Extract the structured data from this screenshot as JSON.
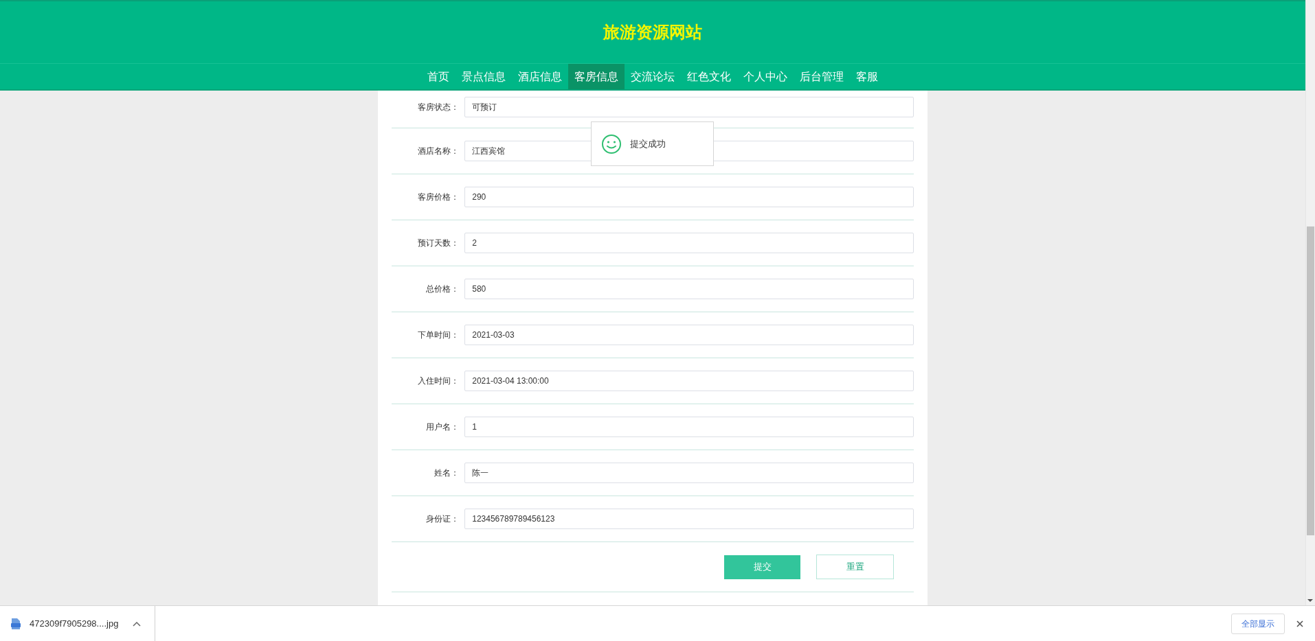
{
  "site_title": "旅游资源网站",
  "nav": [
    {
      "label": "首页",
      "selected": false
    },
    {
      "label": "景点信息",
      "selected": false
    },
    {
      "label": "酒店信息",
      "selected": false
    },
    {
      "label": "客房信息",
      "selected": true
    },
    {
      "label": "交流论坛",
      "selected": false
    },
    {
      "label": "红色文化",
      "selected": false
    },
    {
      "label": "个人中心",
      "selected": false
    },
    {
      "label": "后台管理",
      "selected": false
    },
    {
      "label": "客服",
      "selected": false
    }
  ],
  "form": {
    "fields": [
      {
        "label": "客房状态：",
        "value": "可预订"
      },
      {
        "label": "酒店名称：",
        "value": "江西宾馆"
      },
      {
        "label": "客房价格：",
        "value": "290"
      },
      {
        "label": "预订天数：",
        "value": "2"
      },
      {
        "label": "总价格：",
        "value": "580"
      },
      {
        "label": "下单时间：",
        "value": "2021-03-03"
      },
      {
        "label": "入住时间：",
        "value": "2021-03-04 13:00:00"
      },
      {
        "label": "用户名：",
        "value": "1"
      },
      {
        "label": "姓名：",
        "value": "陈一"
      },
      {
        "label": "身份证：",
        "value": "123456789789456123"
      }
    ],
    "buttons": [
      {
        "label": "提交",
        "kind": "primary"
      },
      {
        "label": "重置",
        "kind": "secondary"
      }
    ]
  },
  "toast": {
    "message": "提交成功"
  },
  "download_bar": {
    "file": "472309f7905298....jpg",
    "show_all": "全部显示"
  }
}
